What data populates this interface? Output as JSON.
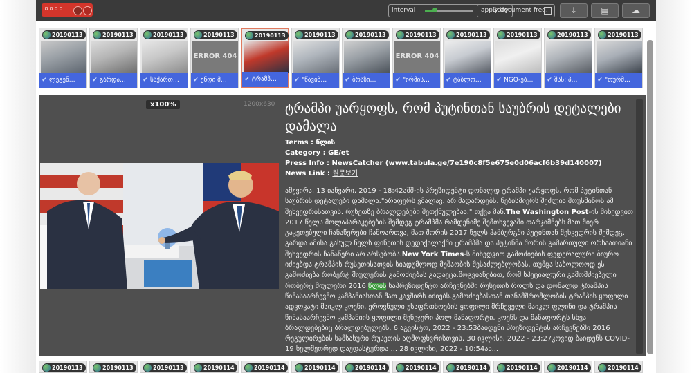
{
  "toolbar": {
    "badge_text": "▫▫▫▫",
    "interval_label": "interval",
    "interval_value": "3day",
    "apply_label": "apply document freq.",
    "btn_sort": "↓",
    "btn_view": "▤",
    "btn_cloud": "☁"
  },
  "top_strip": [
    {
      "date": "20190113",
      "caption": "ლეგენ…",
      "thumb": "photo"
    },
    {
      "date": "20190113",
      "caption": "გარდა…",
      "thumb": "photo"
    },
    {
      "date": "20190113",
      "caption": "საქართ…",
      "thumb": "photo"
    },
    {
      "date": "20190113",
      "caption": "ენდი მ…",
      "thumb": "error",
      "error_text": "ERROR 404"
    },
    {
      "date": "20190113",
      "caption": "ტრამპ…",
      "thumb": "photo",
      "selected": true
    },
    {
      "date": "20190113",
      "caption": "\"წავიწ…",
      "thumb": "photo"
    },
    {
      "date": "20190113",
      "caption": "ბრაზი…",
      "thumb": "photo"
    },
    {
      "date": "20190113",
      "caption": "\"ირმის…",
      "thumb": "error",
      "error_text": "ERROR 404"
    },
    {
      "date": "20190113",
      "caption": "ტაბლო…",
      "thumb": "photo"
    },
    {
      "date": "20190113",
      "caption": "NGO-ებ…",
      "thumb": "photo"
    },
    {
      "date": "20190113",
      "caption": "შსს: პ…",
      "thumb": "photo"
    },
    {
      "date": "20190113",
      "caption": "\"თურმ…",
      "thumb": "photo"
    }
  ],
  "bottom_strip_dates": [
    "20190113",
    "20190113",
    "20190113",
    "20190114",
    "20190114",
    "20190114",
    "20190114",
    "20190114",
    "20190114",
    "20190114",
    "20190114",
    "20190114"
  ],
  "viewer": {
    "zoom": "x100%",
    "dimensions": "1200x630"
  },
  "article": {
    "title": "ტრამპი უარყოფს, რომ პუტინთან საუბრის დეტალები დამალა",
    "terms_label": "Terms :",
    "terms_value": "წლის",
    "category_label": "Category  :",
    "category_value": "GE/et",
    "press_label": "Press Info :",
    "press_value": "NewsCatcher (www.tabula.ge/7e190c8f5e675e0d06acf6b39d140007)",
    "link_label": "News Link :",
    "link_value": "원문보기",
    "body_1": "ამჟვირა, 13 იანვარი, 2019 - 18:42აშშ-ის პრეზიდენტი დონალდ ტრამპი უარყოფს, რომ პუტინთან საუბრის დეტალები დამალა.\"არაფერს ვმალავ. არ მადარდებს. ნებისმიერს შეძლია მოუსმინოს ამ შეხვედრისათვის. რუსეთზე ბრალდებები შეთქმულებაა.\" თქვა მან.",
    "bold_1": "The Washington Post",
    "body_2": "-ის მიხედვით 2017 წელს მოლაპარაკებების შემდეგ ტრამპმა რამდენიმე შემთხვევაში თარჯიმნებს მათ მიერ გაკეთებული ჩანაწერები ჩამოართვა, მათ შორის 2017 წელს ჰამბურგში პუტინთან შეხვედრის შემდეგ. გარდა ამისა გასულ წელს ფინეთის დედაქალაქში ტრამპმა და პუტინმა შორის გამართული ორსაათიანი შეხვედრის ჩანაწერი არ არსებობს.",
    "bold_2": "New York Times",
    "body_3": "-ს მიხედვით გამოძიების ფედერალური ბიურო იძიებდა ტრამპის რუსეთისათვის სიადუმლოდ მუშაობის შესაძლებლობას, თუმცა საბოლოოდ ეს გამოძიება რობერტ მიულერის გამოძიებას გადაეცა.მოგვიანებით, რომ სპეციალური გამომძიებელი რობერტ მიულერი 2016 ",
    "highlight": "წლის",
    "body_4": " საპრეზიდენტო არჩევნებში რუსეთის როლს და დონალდ ტრამპის წინასაარჩევნო კამპანიასთან მათ კავშირს იძიებს.გამოძიებასთან თანამშრომლობის ტრამპის ყოფილი ადვოკატი მაიკლ კოენი, ეროვნული უსაფრთხოების ყოფილი მრჩეველი მაიკლ ფლინი და ტრამპის წინასაარჩევნო კამპანიის ყოფილი მენეჯერი პოლ მანაფორტი. კოენს და მანაფორტს სხვა ბრალდებებიც ბრალდებულებს, 6 აგვისტო, 2022 - 23:53ბაიდენი პრეზიდენტის არჩევნებში 2016 რეგულირების სამსახური რუსეთის აღმოფხვრისთვის, 30 ივლისი, 2022 - 23:27კოვიდ ბაიდენს COVID-19 ხელმეორედ დაუდასტურდა ... 28 ივლისი, 2022 - 10:54ახ..."
  }
}
